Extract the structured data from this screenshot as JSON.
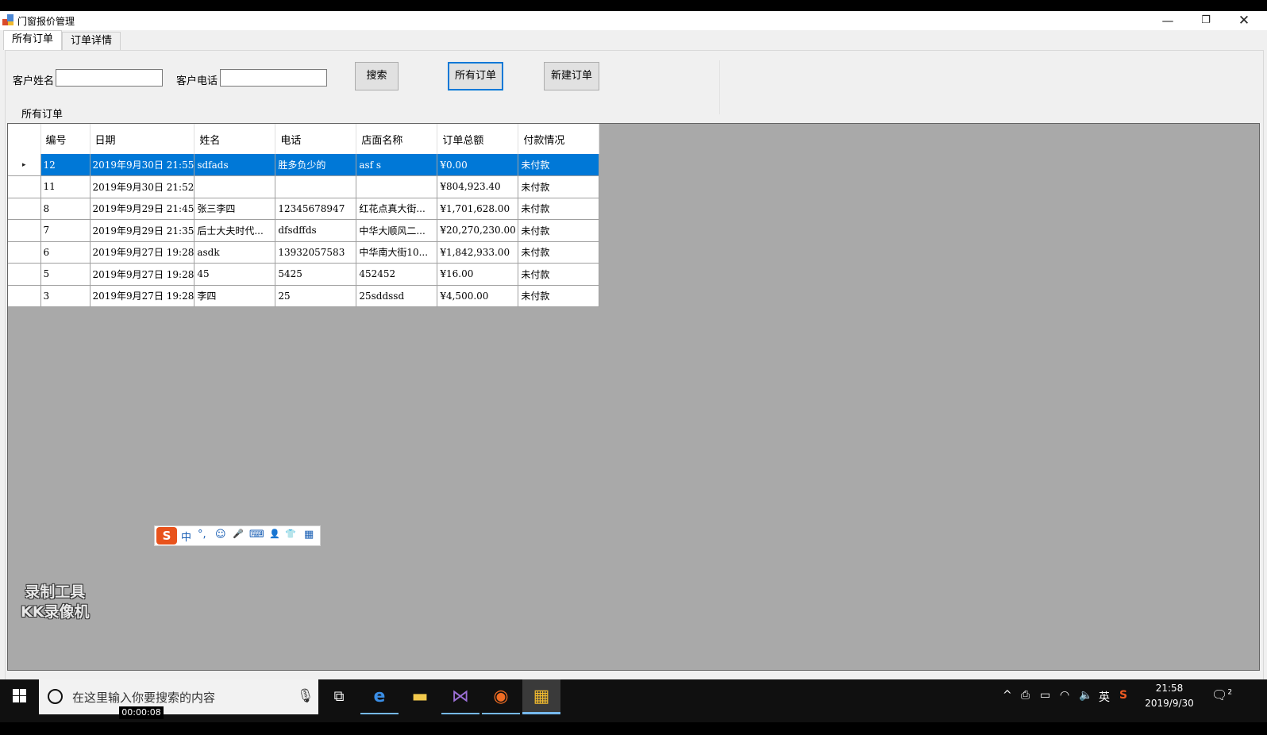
{
  "window": {
    "title": "门窗报价管理",
    "controls": {
      "minimize": "—",
      "maximize": "❐",
      "close": "✕"
    }
  },
  "tabs": [
    {
      "label": "所有订单",
      "active": true
    },
    {
      "label": "订单详情",
      "active": false
    }
  ],
  "search": {
    "name_label": "客户姓名",
    "name_value": "",
    "phone_label": "客户电话",
    "phone_value": "",
    "search_button": "搜索",
    "all_orders_button": "所有订单",
    "new_order_button": "新建订单"
  },
  "section_label": "所有订单",
  "grid": {
    "columns": [
      "编号",
      "日期",
      "姓名",
      "电话",
      "店面名称",
      "订单总额",
      "付款情况"
    ],
    "current_row_marker": "▸",
    "rows": [
      [
        "12",
        "2019年9月30日 21:55",
        "sdfads",
        "胜多负少的",
        "asf s",
        "¥0.00",
        "未付款"
      ],
      [
        "11",
        "2019年9月30日 21:52",
        "",
        "",
        "",
        "¥804,923.40",
        "未付款"
      ],
      [
        "8",
        "2019年9月29日 21:45",
        "张三李四",
        "12345678947",
        "红花点真大街...",
        "¥1,701,628.00",
        "未付款"
      ],
      [
        "7",
        "2019年9月29日 21:35",
        "后士大夫时代...",
        "dfsdffds",
        "中华大顺风二...",
        "¥20,270,230.00",
        "未付款"
      ],
      [
        "6",
        "2019年9月27日 19:28",
        "asdk",
        "13932057583",
        "中华南大街10...",
        "¥1,842,933.00",
        "未付款"
      ],
      [
        "5",
        "2019年9月27日 19:28",
        "45",
        "5425",
        "452452",
        "¥16.00",
        "未付款"
      ],
      [
        "3",
        "2019年9月27日 19:28",
        "李四",
        "25",
        "25sddssd",
        "¥4,500.00",
        "未付款"
      ]
    ],
    "selected_row": 0
  },
  "ime_bar": {
    "logo": "S",
    "mode": "中",
    "punct": "°,",
    "icons": [
      "☺",
      "🎤",
      "⌨",
      "👤",
      "👕",
      "▦"
    ]
  },
  "watermark": {
    "line1": "录制工具",
    "line2": "KK录像机"
  },
  "taskbar": {
    "search_placeholder": "在这里输入你要搜索的内容",
    "timer": "00:00:08",
    "clock_time": "21:58",
    "clock_date": "2019/9/30",
    "input_lang": "英",
    "notifications": "2"
  },
  "colors": {
    "selection": "#0078d7",
    "grid_background": "#a9a9a9",
    "window_background": "#f0f0f0"
  }
}
